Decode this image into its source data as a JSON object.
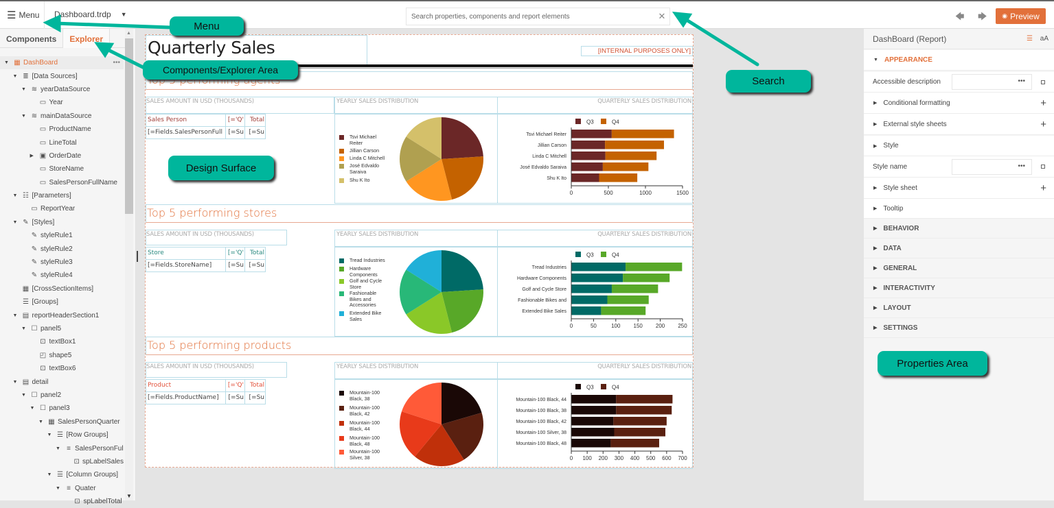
{
  "topbar": {
    "menu_label": "Menu",
    "file_name": "Dashboard.trdp",
    "search_placeholder": "Search properties, components and report elements",
    "preview_label": "Preview",
    "undo_icon": "undo-icon",
    "redo_icon": "redo-icon"
  },
  "left_panel": {
    "tabs": [
      {
        "label": "Components"
      },
      {
        "label": "Explorer",
        "active": true
      }
    ],
    "tree": [
      {
        "label": "DashBoard",
        "depth": 0,
        "toggle": "down",
        "icon": "report-icon",
        "selected": true
      },
      {
        "label": "[Data Sources]",
        "depth": 1,
        "toggle": "down",
        "icon": "database-icon"
      },
      {
        "label": "yearDataSource",
        "depth": 2,
        "toggle": "down",
        "icon": "datasource-icon"
      },
      {
        "label": "Year",
        "depth": 3,
        "toggle": "",
        "icon": "number-field-icon"
      },
      {
        "label": "mainDataSource",
        "depth": 2,
        "toggle": "down",
        "icon": "datasource-icon"
      },
      {
        "label": "ProductName",
        "depth": 3,
        "toggle": "",
        "icon": "string-field-icon"
      },
      {
        "label": "LineTotal",
        "depth": 3,
        "toggle": "",
        "icon": "decimal-field-icon"
      },
      {
        "label": "OrderDate",
        "depth": 3,
        "toggle": "right",
        "icon": "date-field-icon"
      },
      {
        "label": "StoreName",
        "depth": 3,
        "toggle": "",
        "icon": "string-field-icon"
      },
      {
        "label": "SalesPersonFullName",
        "depth": 3,
        "toggle": "",
        "icon": "string-field-icon"
      },
      {
        "label": "[Parameters]",
        "depth": 1,
        "toggle": "down",
        "icon": "parameters-icon"
      },
      {
        "label": "ReportYear",
        "depth": 2,
        "toggle": "",
        "icon": "number-field-icon"
      },
      {
        "label": "[Styles]",
        "depth": 1,
        "toggle": "down",
        "icon": "styles-icon"
      },
      {
        "label": "styleRule1",
        "depth": 2,
        "toggle": "",
        "icon": "style-rule-icon"
      },
      {
        "label": "styleRule2",
        "depth": 2,
        "toggle": "",
        "icon": "style-rule-icon"
      },
      {
        "label": "styleRule3",
        "depth": 2,
        "toggle": "",
        "icon": "style-rule-icon"
      },
      {
        "label": "styleRule4",
        "depth": 2,
        "toggle": "",
        "icon": "style-rule-icon"
      },
      {
        "label": "[CrossSectionItems]",
        "depth": 1,
        "toggle": "",
        "icon": "grid-icon"
      },
      {
        "label": "[Groups]",
        "depth": 1,
        "toggle": "",
        "icon": "groups-icon"
      },
      {
        "label": "reportHeaderSection1",
        "depth": 1,
        "toggle": "down",
        "icon": "section-icon"
      },
      {
        "label": "panel5",
        "depth": 2,
        "toggle": "down",
        "icon": "panel-icon"
      },
      {
        "label": "textBox1",
        "depth": 3,
        "toggle": "",
        "icon": "textbox-icon"
      },
      {
        "label": "shape5",
        "depth": 3,
        "toggle": "",
        "icon": "shape-icon"
      },
      {
        "label": "textBox6",
        "depth": 3,
        "toggle": "",
        "icon": "textbox-icon"
      },
      {
        "label": "detail",
        "depth": 1,
        "toggle": "down",
        "icon": "detail-section-icon"
      },
      {
        "label": "panel2",
        "depth": 2,
        "toggle": "down",
        "icon": "panel-icon"
      },
      {
        "label": "panel3",
        "depth": 3,
        "toggle": "down",
        "icon": "panel-icon"
      },
      {
        "label": "SalesPersonQuarter",
        "depth": 4,
        "toggle": "down",
        "icon": "grid-icon"
      },
      {
        "label": "[Row Groups]",
        "depth": 5,
        "toggle": "down",
        "icon": "groups-icon"
      },
      {
        "label": "SalesPersonFul",
        "depth": 6,
        "toggle": "down",
        "icon": "group-icon"
      },
      {
        "label": "spLabelSales",
        "depth": 7,
        "toggle": "",
        "icon": "textbox-icon"
      },
      {
        "label": "[Column Groups]",
        "depth": 5,
        "toggle": "down",
        "icon": "groups-icon"
      },
      {
        "label": "Quater",
        "depth": 6,
        "toggle": "down",
        "icon": "group-icon"
      },
      {
        "label": "spLabelTotal",
        "depth": 7,
        "toggle": "",
        "icon": "textbox-icon"
      }
    ]
  },
  "report": {
    "title": "Quarterly Sales",
    "internal_label": "[INTERNAL PURPOSES ONLY]",
    "sections": [
      {
        "title": "Top 5 performing agents",
        "col_header_1": "SALES AMOUNT IN USD (THOUSANDS)",
        "col_header_2": "YEARLY SALES DISTRIBUTION",
        "col_header_3": "QUARTERLY SALES DISTRIBUTION",
        "table_header": [
          "Sales Person",
          "[='Q'",
          "Total"
        ],
        "table_row": [
          "[=Fields.SalesPersonFull",
          "[=Su",
          "[=Su"
        ],
        "header_color": "#a0403a"
      },
      {
        "title": "Top 5 performing stores",
        "col_header_1": "SALES AMOUNT IN USD (THOUSANDS)",
        "col_header_2": "YEARLY SALES DISTRIBUTION",
        "col_header_3": "QUARTERLY SALES DISTRIBUTION",
        "table_header": [
          "Store",
          "[='Q'",
          "Total"
        ],
        "table_row": [
          "[=Fields.StoreName]",
          "[=Su",
          "[=Su"
        ],
        "header_color": "#2a8a80"
      },
      {
        "title": "Top 5 performing products",
        "col_header_1": "SALES AMOUNT IN USD (THOUSANDS)",
        "col_header_2": "YEARLY SALES DISTRIBUTION",
        "col_header_3": "QUARTERLY SALES DISTRIBUTION",
        "table_header": [
          "Product",
          "[='Q'",
          "Total"
        ],
        "table_row": [
          "[=Fields.ProductName]",
          "[=Su",
          "[=Su"
        ],
        "header_color": "#e2503a"
      }
    ]
  },
  "chart_data": [
    {
      "type": "pie",
      "title": "YEARLY SALES DISTRIBUTION",
      "categories": [
        "Tsvi Michael Reiter",
        "Jillian  Carson",
        "Linda C Mitchell",
        "José Edvaldo Saraiva",
        "Shu K Ito"
      ],
      "values": [
        24,
        22,
        20,
        18,
        16
      ],
      "colors": [
        "#6b2727",
        "#c46200",
        "#ff9620",
        "#b0a050",
        "#d4c06a"
      ],
      "legend": "left"
    },
    {
      "type": "bar",
      "orientation": "horizontal",
      "stacked": true,
      "title": "QUARTERLY SALES DISTRIBUTION",
      "categories": [
        "Tsvi Michael Reiter",
        "Jillian  Carson",
        "Linda C Mitchell",
        "José Edvaldo Saraiva",
        "Shu K Ito"
      ],
      "series": [
        {
          "name": "Q3",
          "values": [
            545,
            455,
            460,
            425,
            375
          ],
          "color": "#6b2727"
        },
        {
          "name": "Q4",
          "values": [
            840,
            795,
            690,
            615,
            515
          ],
          "color": "#c46200"
        }
      ],
      "xlim": [
        0,
        1500
      ],
      "xticks": [
        0,
        500,
        1000,
        1500
      ],
      "legend": "top"
    },
    {
      "type": "pie",
      "title": "YEARLY SALES DISTRIBUTION",
      "categories": [
        "Tread Industries",
        "Hardware Components",
        "Golf and Cycle Store",
        "Fashionable Bikes and Accessories",
        "Extended Bike Sales"
      ],
      "legend_labels": [
        "Tread Industries",
        "Hardware\nComponents",
        "Golf and Cycle\nStore",
        "Fashionable\nBikes and\nAccessories",
        "Extended Bike\nSales"
      ],
      "values": [
        24,
        22,
        20,
        18,
        16
      ],
      "colors": [
        "#006a66",
        "#58a828",
        "#8ac828",
        "#28b878",
        "#20b0d8"
      ],
      "legend": "left"
    },
    {
      "type": "bar",
      "orientation": "horizontal",
      "stacked": true,
      "title": "QUARTERLY SALES DISTRIBUTION",
      "categories": [
        "Tread Industries",
        "Hardware Components",
        "Golf and Cycle Store",
        "Fashionable Bikes and",
        "Extended Bike Sales"
      ],
      "series": [
        {
          "name": "Q3",
          "values": [
            122,
            116,
            91,
            81,
            67
          ],
          "color": "#006a66"
        },
        {
          "name": "Q4",
          "values": [
            127,
            105,
            104,
            93,
            100
          ],
          "color": "#58a828"
        }
      ],
      "xlim": [
        0,
        250
      ],
      "xticks": [
        0,
        50,
        100,
        150,
        200,
        250
      ],
      "legend": "top"
    },
    {
      "type": "pie",
      "title": "YEARLY SALES DISTRIBUTION",
      "categories": [
        "Mountain-100 Black, 38",
        "Mountain-100 Black, 42",
        "Mountain-100 Black, 44",
        "Mountain-100 Black, 48",
        "Mountain-100 Silver, 38"
      ],
      "legend_labels": [
        "Mountain-100\nBlack, 38",
        "Mountain-100\nBlack, 42",
        "Mountain-100\nBlack, 44",
        "Mountain-100\nBlack, 48",
        "Mountain-100\nSilver, 38"
      ],
      "values": [
        20.5,
        20.5,
        20,
        19,
        20
      ],
      "colors": [
        "#1a0806",
        "#5a2010",
        "#c0300a",
        "#e83a1a",
        "#ff5a38"
      ],
      "legend": "left"
    },
    {
      "type": "bar",
      "orientation": "horizontal",
      "stacked": true,
      "title": "QUARTERLY SALES DISTRIBUTION",
      "categories": [
        "Mountain-100 Black, 44",
        "Mountain-100 Black, 38",
        "Mountain-100 Black, 42",
        "Mountain-100 Silver, 38",
        "Mountain-100 Black, 48"
      ],
      "series": [
        {
          "name": "Q3",
          "values": [
            282,
            282,
            265,
            270,
            248
          ],
          "color": "#1a0806"
        },
        {
          "name": "Q4",
          "values": [
            355,
            350,
            335,
            322,
            305
          ],
          "color": "#5a2010"
        }
      ],
      "xlim": [
        0,
        700
      ],
      "xticks": [
        0,
        100,
        200,
        300,
        400,
        500,
        600,
        700
      ],
      "legend": "top"
    }
  ],
  "right_panel": {
    "title": "DashBoard (Report)",
    "sort_icon": "categorized-icon",
    "alpha_label": "aA",
    "rows": [
      {
        "label": "APPEARANCE",
        "kind": "open-category"
      },
      {
        "label": "Accessible description",
        "kind": "field",
        "dots": "•••"
      },
      {
        "label": "Conditional formatting",
        "kind": "expander",
        "plus": true
      },
      {
        "label": "External style sheets",
        "kind": "expander",
        "plus": true
      },
      {
        "label": "Style",
        "kind": "expander",
        "plus": false
      },
      {
        "label": "Style name",
        "kind": "field",
        "dots": "•••"
      },
      {
        "label": "Style sheet",
        "kind": "expander",
        "plus": true
      },
      {
        "label": "Tooltip",
        "kind": "expander",
        "plus": false
      },
      {
        "label": "BEHAVIOR",
        "kind": "category"
      },
      {
        "label": "DATA",
        "kind": "category"
      },
      {
        "label": "GENERAL",
        "kind": "category"
      },
      {
        "label": "INTERACTIVITY",
        "kind": "category"
      },
      {
        "label": "LAYOUT",
        "kind": "category"
      },
      {
        "label": "SETTINGS",
        "kind": "category"
      }
    ]
  },
  "callouts": {
    "menu": "Menu",
    "explorer": "Components/Explorer Area",
    "search": "Search",
    "design": "Design Surface",
    "properties": "Properties Area",
    "color": "#00b69c"
  }
}
